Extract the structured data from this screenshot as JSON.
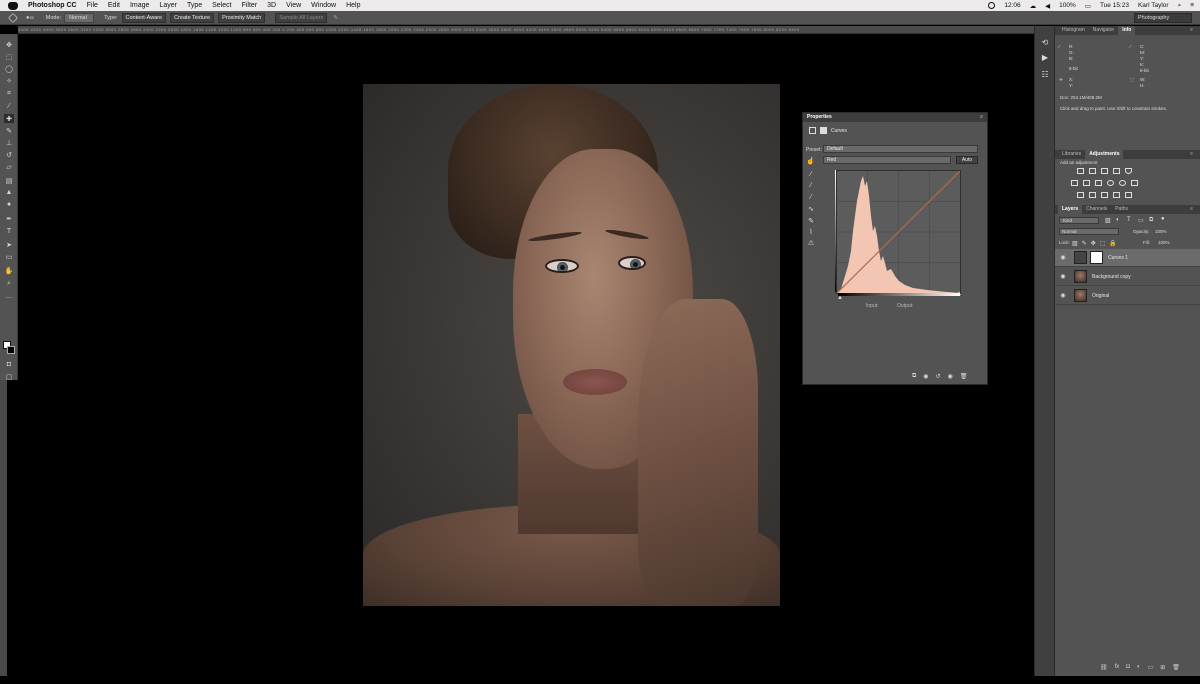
{
  "menubar": {
    "app_name": "Photoshop CC",
    "menus": [
      "File",
      "Edit",
      "Image",
      "Layer",
      "Type",
      "Select",
      "3D",
      "View",
      "Window",
      "Help"
    ],
    "time_left": "12:06",
    "battery": "100%",
    "clock": "Tue 15:23",
    "user": "Karl Taylor"
  },
  "options_bar": {
    "brush_size": "25",
    "mode_label": "Mode:",
    "mode_value": "Normal",
    "type_label": "Type:",
    "type_buttons": [
      "Content-Aware",
      "Create Texture",
      "Proximity Match"
    ],
    "sample_all_layers": "Sample All Layers",
    "workspace": "Photography"
  },
  "ruler": {
    "ticks": "4400 4200 4000 3800 3600 3400 3200 3000 2800 2600 2400 2200 2000 1800 1600 1400 1200 1000 800 600 400 200 0 200 400 600 800 1000 1200 1400 1600 1800 2000 2200 2400 2600 2800 3000 3200 3400 3600 3800 4000 4200 4400 4600 4800 5000 5200 5400 5600 5800 6000 6200 6400 6600 6800 7000 7200 7400 7600 7800 8000 8200 8400"
  },
  "properties": {
    "title": "Properties",
    "subtitle": "Curves",
    "preset_label": "Preset:",
    "preset_value": "Default",
    "channel_value": "Red",
    "auto_label": "Auto",
    "input_label": "Input:",
    "output_label": "Output:",
    "histogram_color": "#f3c6b4",
    "curve_color": "#b06a52"
  },
  "info_panel": {
    "tabs": [
      "Histogram",
      "Navigator",
      "Info"
    ],
    "active_tab": "Info",
    "r_label": "R:",
    "g_label": "G:",
    "b_label": "B:",
    "c_label": "C:",
    "m_label": "M:",
    "y_label": "Y:",
    "k_label": "K:",
    "bit_left": "8-bit",
    "bit_right": "8-bit",
    "x_label": "X:",
    "y2_label": "Y:",
    "w_label": "W:",
    "h_label": "H:",
    "doc": "Doc: 204.1M/408.2M",
    "hint": "Click and drag to paint. Use Shift to constrain strokes."
  },
  "adjustments_panel": {
    "tabs": [
      "Libraries",
      "Adjustments"
    ],
    "active_tab": "Adjustments",
    "add_label": "Add an adjustment"
  },
  "layers_panel": {
    "tabs": [
      "Layers",
      "Channels",
      "Paths"
    ],
    "active_tab": "Layers",
    "kind": "Kind",
    "blend_mode": "Normal",
    "opacity_label": "Opacity:",
    "opacity_value": "100%",
    "lock_label": "Lock:",
    "fill_label": "Fill:",
    "fill_value": "100%",
    "layers": [
      {
        "name": "Curves 1",
        "type": "adjustment",
        "selected": true
      },
      {
        "name": "Background copy",
        "type": "image",
        "selected": false
      },
      {
        "name": "Original",
        "type": "image",
        "selected": false
      }
    ]
  }
}
